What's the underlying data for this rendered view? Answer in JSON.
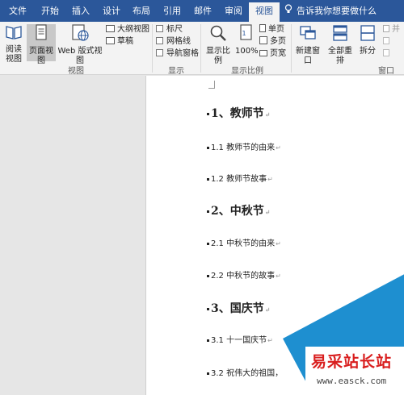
{
  "tabs": [
    "文件",
    "开始",
    "插入",
    "设计",
    "布局",
    "引用",
    "邮件",
    "审阅",
    "视图"
  ],
  "active_tab": "视图",
  "tell_me": "告诉我你想要做什么",
  "ribbon": {
    "views": {
      "read_mode": "阅读视图",
      "print_layout": "页面视图",
      "web_layout": "Web 版式视图",
      "outline": "大纲视图",
      "draft": "草稿",
      "group_label": "视图"
    },
    "show": {
      "ruler": "标尺",
      "gridlines": "网格线",
      "nav_pane": "导航窗格",
      "group_label": "显示"
    },
    "zoom": {
      "zoom": "显示比例",
      "hundred": "100%",
      "one_page": "单页",
      "multi_page": "多页",
      "page_width": "页宽",
      "group_label": "显示比例"
    },
    "window": {
      "new_window": "新建窗口",
      "arrange_all": "全部重排",
      "split": "拆分",
      "side_by_side": "并",
      "group_label": "窗口"
    }
  },
  "document": {
    "lines": [
      {
        "text": "1、教师节",
        "style": "h1"
      },
      {
        "text": "1.1 教师节的由来",
        "style": "h2"
      },
      {
        "text": "1.2 教师节故事",
        "style": "h2"
      },
      {
        "text": "2、中秋节",
        "style": "h1"
      },
      {
        "text": "2.1    中秋节的由来",
        "style": "h2"
      },
      {
        "text": "2.2    中秋节的故事",
        "style": "h2"
      },
      {
        "text": "3、国庆节",
        "style": "h1"
      },
      {
        "text": "3.1  十一国庆节",
        "style": "h2"
      },
      {
        "text": "3.2    祝伟大的祖国，",
        "style": "h2"
      }
    ],
    "paragraph_mark": "↵"
  },
  "watermark": {
    "title": "易采站长站",
    "url": "www.easck.com"
  },
  "colors": {
    "ribbon_blue": "#2b579a",
    "watermark_red": "#d91e1e"
  }
}
